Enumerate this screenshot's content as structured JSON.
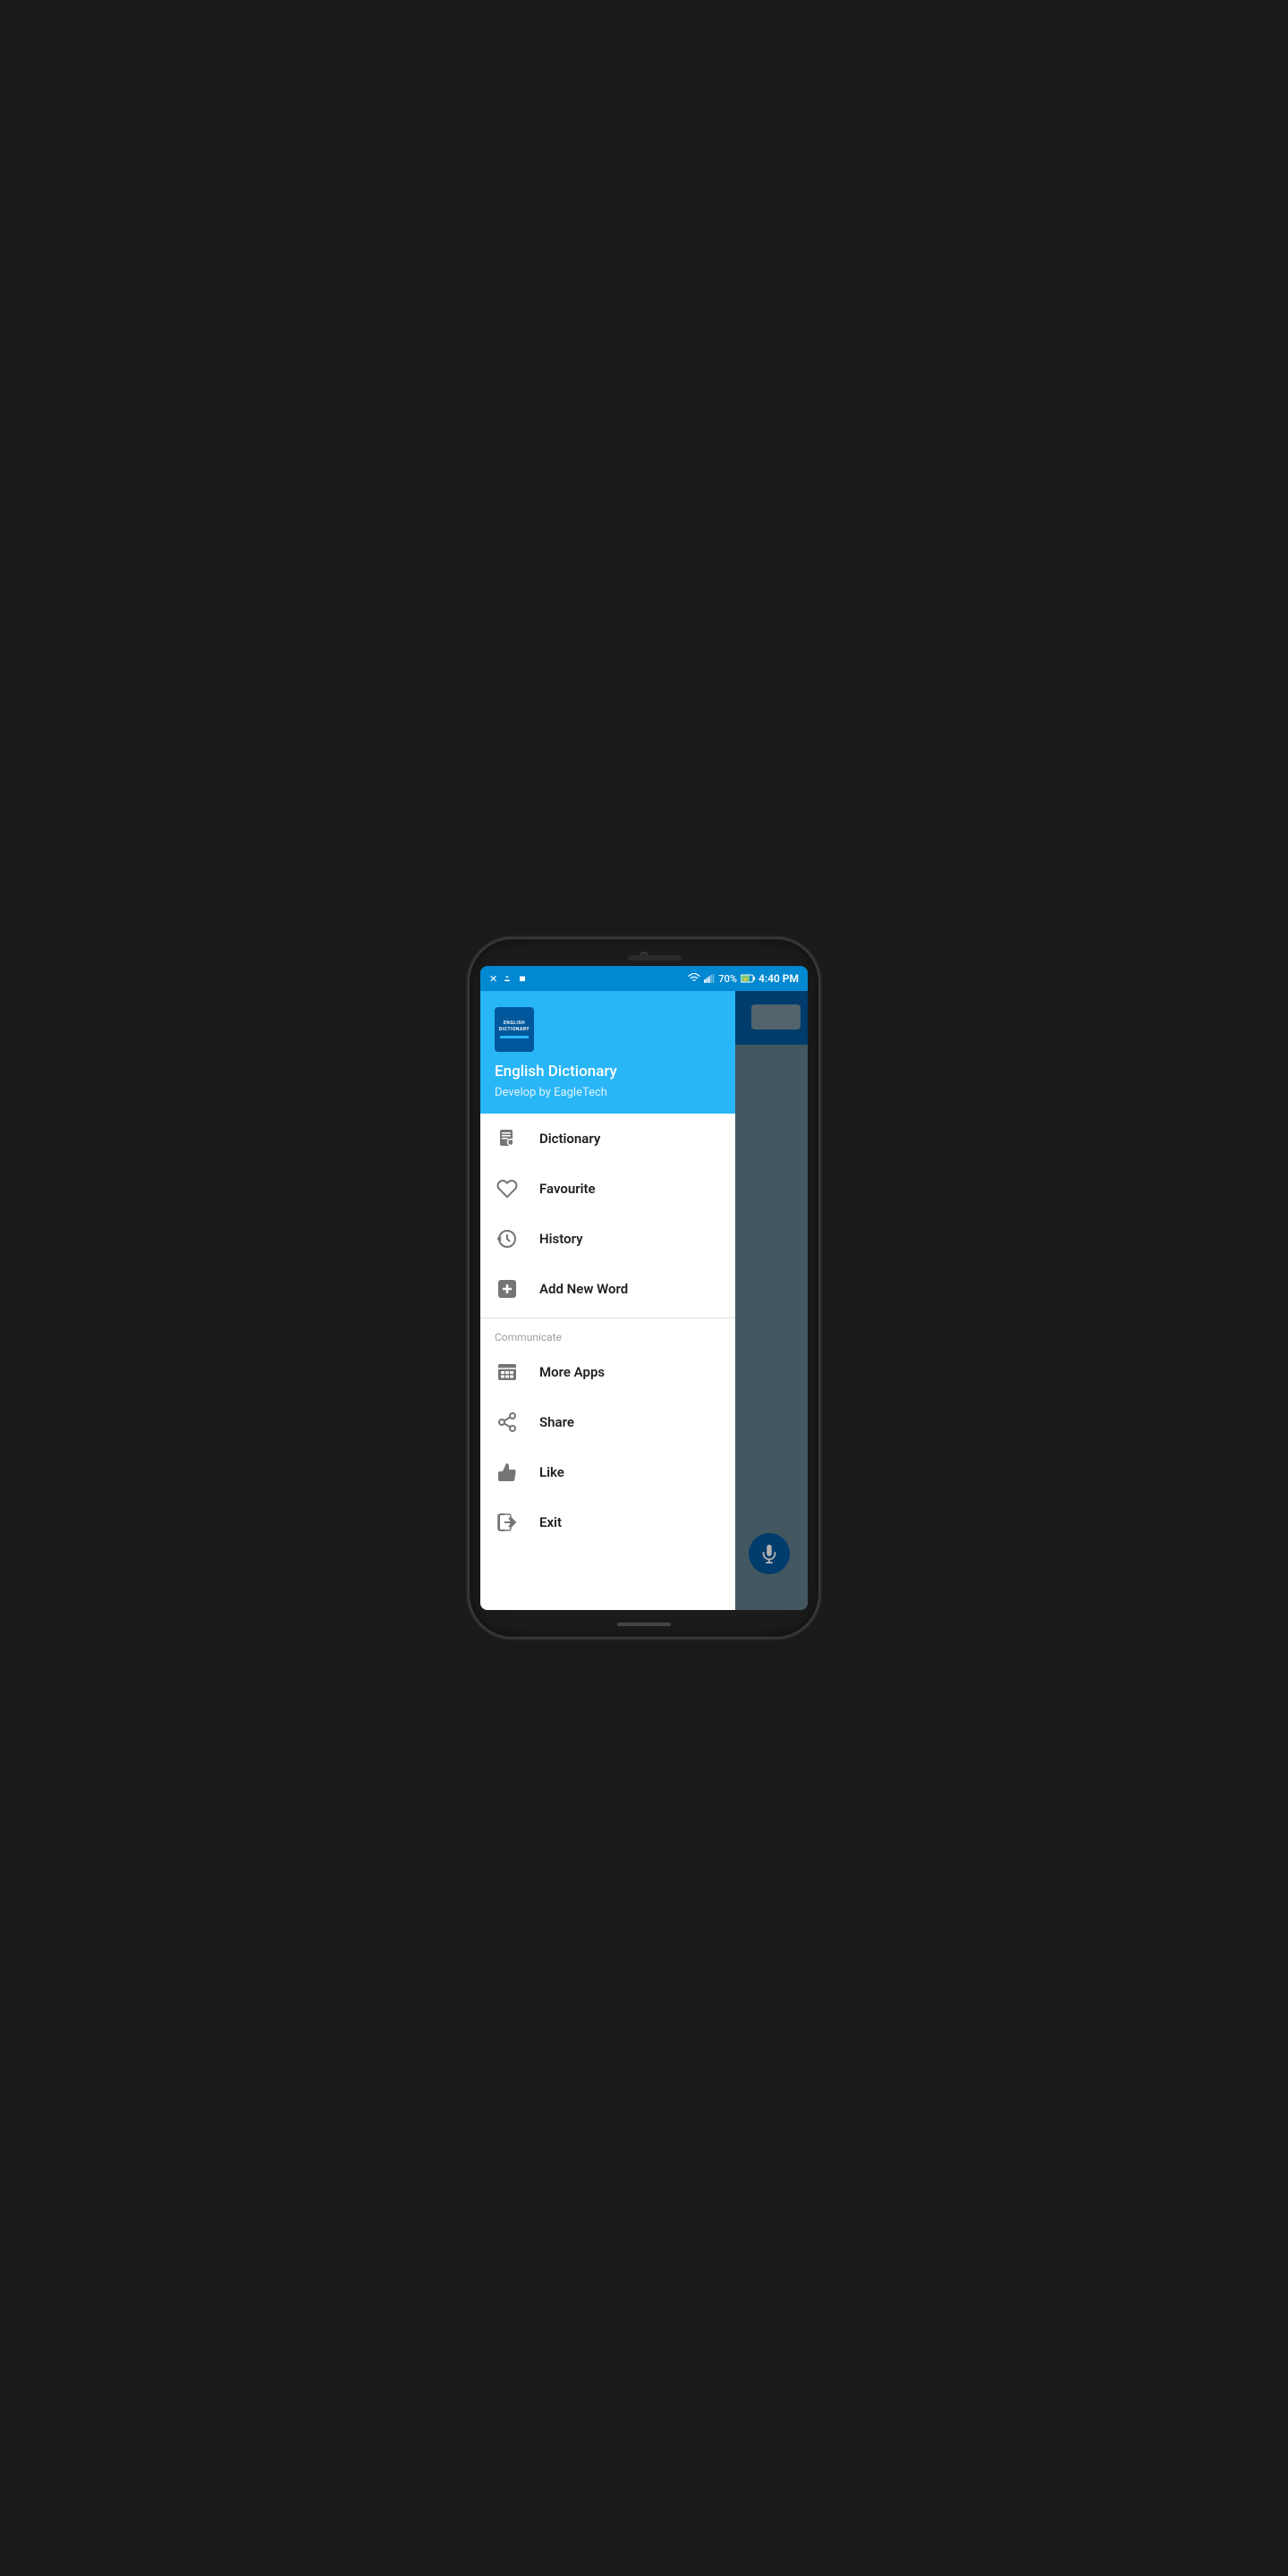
{
  "status_bar": {
    "time": "4:40 PM",
    "battery": "70%",
    "icons_left": [
      "×",
      "usb",
      "android"
    ]
  },
  "app": {
    "name": "English Dictionary",
    "subtitle": "Develop by EagleTech",
    "logo_line1": "ENGLISH",
    "logo_line2": "DICTIONARY"
  },
  "menu_items": [
    {
      "id": "dictionary",
      "label": "Dictionary",
      "icon": "book"
    },
    {
      "id": "favourite",
      "label": "Favourite",
      "icon": "heart"
    },
    {
      "id": "history",
      "label": "History",
      "icon": "history"
    },
    {
      "id": "add-new-word",
      "label": "Add New Word",
      "icon": "plus-square"
    }
  ],
  "section_label": "Communicate",
  "communicate_items": [
    {
      "id": "more-apps",
      "label": "More Apps",
      "icon": "apps"
    },
    {
      "id": "share",
      "label": "Share",
      "icon": "share"
    },
    {
      "id": "like",
      "label": "Like",
      "icon": "thumbs-up"
    },
    {
      "id": "exit",
      "label": "Exit",
      "icon": "exit"
    }
  ]
}
